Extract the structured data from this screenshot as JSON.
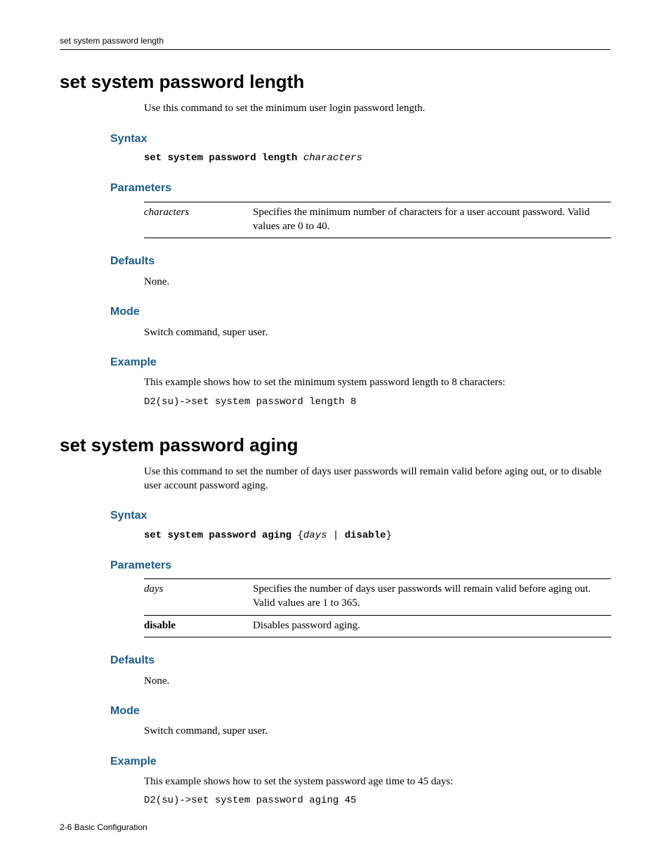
{
  "running_head": "set system password length",
  "footer": "2-6   Basic Configuration",
  "sections": [
    {
      "title": "set system password length",
      "intro": "Use this command to set the minimum user login password length.",
      "syntax_label": "Syntax",
      "syntax_cmd": "set system password length",
      "syntax_arg": "characters",
      "syntax_suffix": "",
      "parameters_label": "Parameters",
      "params": [
        {
          "name": "characters",
          "style": "ital",
          "desc": "Specifies the minimum number of characters for a user account password. Valid values are 0 to 40."
        }
      ],
      "defaults_label": "Defaults",
      "defaults_text": "None.",
      "mode_label": "Mode",
      "mode_text": "Switch command, super user.",
      "example_label": "Example",
      "example_intro": "This example shows how to set the minimum system password length to 8 characters:",
      "example_code": "D2(su)->set system password length 8"
    },
    {
      "title": "set system password aging",
      "intro": "Use this command to set the number of days user passwords will remain valid before aging out, or to disable user account password aging.",
      "syntax_label": "Syntax",
      "syntax_cmd": "set system password aging",
      "syntax_arg": "days",
      "syntax_suffix_kw": "disable",
      "parameters_label": "Parameters",
      "params": [
        {
          "name": "days",
          "style": "ital",
          "desc": "Specifies the number of days user passwords will remain valid before aging out. Valid values are 1 to 365."
        },
        {
          "name": "disable",
          "style": "bold",
          "desc": "Disables password aging."
        }
      ],
      "defaults_label": "Defaults",
      "defaults_text": "None.",
      "mode_label": "Mode",
      "mode_text": "Switch command, super user.",
      "example_label": "Example",
      "example_intro": "This example shows how to set the system password age time to 45 days:",
      "example_code": "D2(su)->set system password aging 45"
    }
  ]
}
